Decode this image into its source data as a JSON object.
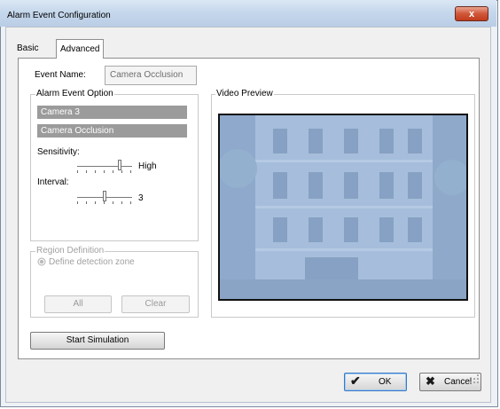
{
  "window": {
    "title": "Alarm Event Configuration",
    "close_glyph": "x"
  },
  "tabs": [
    {
      "label": "Basic",
      "active": false
    },
    {
      "label": "Advanced",
      "active": true
    }
  ],
  "event": {
    "name_label": "Event Name:",
    "name_value": "Camera Occlusion"
  },
  "alarm_option": {
    "title": "Alarm Event Option",
    "camera": "Camera 3",
    "event_type": "Camera Occlusion",
    "sensitivity_label": "Sensitivity:",
    "sensitivity_value": "High",
    "sensitivity_level": 0.8,
    "interval_label": "Interval:",
    "interval_value": "3",
    "interval_level": 0.5
  },
  "region": {
    "title": "Region Definition",
    "radio_label": "Define detection zone",
    "all_label": "All",
    "clear_label": "Clear"
  },
  "video": {
    "title": "Video Preview",
    "tint_color": "#9db7d7"
  },
  "actions": {
    "start_simulation": "Start Simulation",
    "ok": "OK",
    "cancel": "Cancel"
  }
}
